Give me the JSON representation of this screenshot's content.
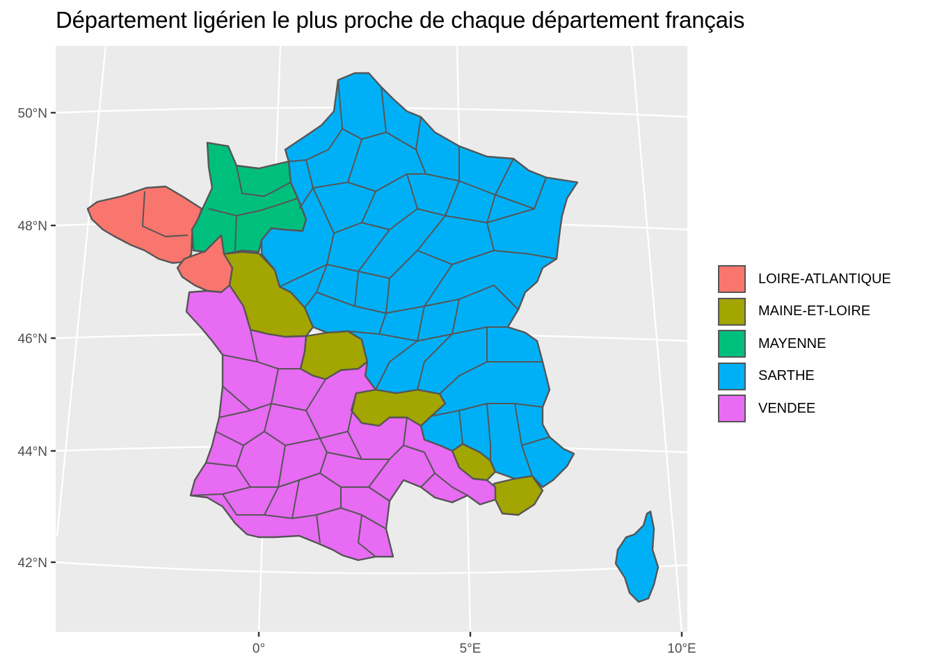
{
  "title": "Département ligérien le plus proche de chaque département français",
  "axes": {
    "x_ticks": [
      "0°",
      "5°E",
      "10°E"
    ],
    "y_ticks": [
      "50°N",
      "48°N",
      "46°N",
      "44°N",
      "42°N"
    ]
  },
  "legend": {
    "items": [
      {
        "label": "LOIRE-ATLANTIQUE",
        "color": "#F8766D"
      },
      {
        "label": "MAINE-ET-LOIRE",
        "color": "#A3A500"
      },
      {
        "label": "MAYENNE",
        "color": "#00BF7D"
      },
      {
        "label": "SARTHE",
        "color": "#00B0F6"
      },
      {
        "label": "VENDEE",
        "color": "#E76BF3"
      }
    ]
  },
  "style": {
    "panel_bg": "#EBEBEB",
    "grid": "#FFFFFF",
    "border": "#555555"
  }
}
